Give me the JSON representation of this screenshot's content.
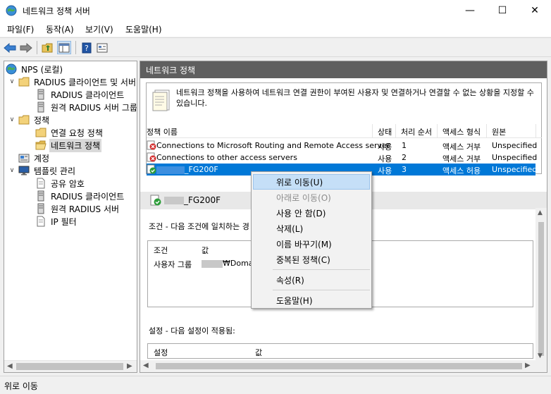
{
  "window": {
    "title": "네트워크 정책 서버"
  },
  "menu": [
    {
      "label": "파일(F)"
    },
    {
      "label": "동작(A)"
    },
    {
      "label": "보기(V)"
    },
    {
      "label": "도움말(H)"
    }
  ],
  "toolbar_icons": [
    "back-arrow-icon",
    "forward-arrow-icon",
    "up-folder-icon",
    "show-tree-icon",
    "help-icon",
    "properties-icon"
  ],
  "tree": {
    "root": "NPS (로컬)",
    "radius_clients_servers": "RADIUS 클라이언트 및 서버",
    "radius_clients": "RADIUS 클라이언트",
    "remote_radius_groups": "원격 RADIUS 서버 그룹",
    "policies": "정책",
    "connection_request_policies": "연결 요청 정책",
    "network_policies": "네트워크 정책",
    "accounting": "계정",
    "templates": "템플릿 관리",
    "shared_secrets": "공유 암호",
    "tpl_radius_clients": "RADIUS 클라이언트",
    "tpl_remote_radius": "원격 RADIUS 서버",
    "ip_filters": "IP 필터"
  },
  "main": {
    "header": "네트워크 정책",
    "description": "네트워크 정책을 사용하여 네트워크 연결 권한이 부여된 사용자 및 연결하거나 연결할 수 없는 상황을 지정할 수 있습니다.",
    "columns": {
      "name": "정책 이름",
      "status": "상태",
      "order": "처리 순서",
      "access": "액세스 형식",
      "source": "원본"
    },
    "rows": [
      {
        "name": "Connections to Microsoft Routing and Remote Access server",
        "status": "사용",
        "order": "1",
        "access": "액세스 거부",
        "source": "Unspecified"
      },
      {
        "name": "Connections to other access servers",
        "status": "사용",
        "order": "2",
        "access": "액세스 거부",
        "source": "Unspecified"
      },
      {
        "name": "_FG200F",
        "status": "사용",
        "order": "3",
        "access": "액세스 허용",
        "source": "Unspecified"
      }
    ],
    "selected_policy": "_FG200F",
    "conditions_title": "조건 - 다음 조건에 일치하는 경",
    "conditions": {
      "col_condition": "조건",
      "col_value": "값",
      "row_condition": "사용자 그룹",
      "row_value": "₩Doma"
    },
    "settings_title": "설정 - 다음 설정이 적용됨:",
    "settings": {
      "col_setting": "설정",
      "col_value": "값"
    }
  },
  "context_menu": {
    "move_up": "위로 이동(U)",
    "move_down": "아래로 이동(O)",
    "disable": "사용 안 함(D)",
    "delete": "삭제(L)",
    "rename": "이름 바꾸기(M)",
    "duplicate": "중복된 정책(C)",
    "properties": "속성(R)",
    "help": "도움말(H)"
  },
  "status": {
    "text": "위로 이동"
  },
  "colors": {
    "selection": "#0078d7",
    "header": "#5f5f5f",
    "menu_highlight": "#c5dff7"
  }
}
